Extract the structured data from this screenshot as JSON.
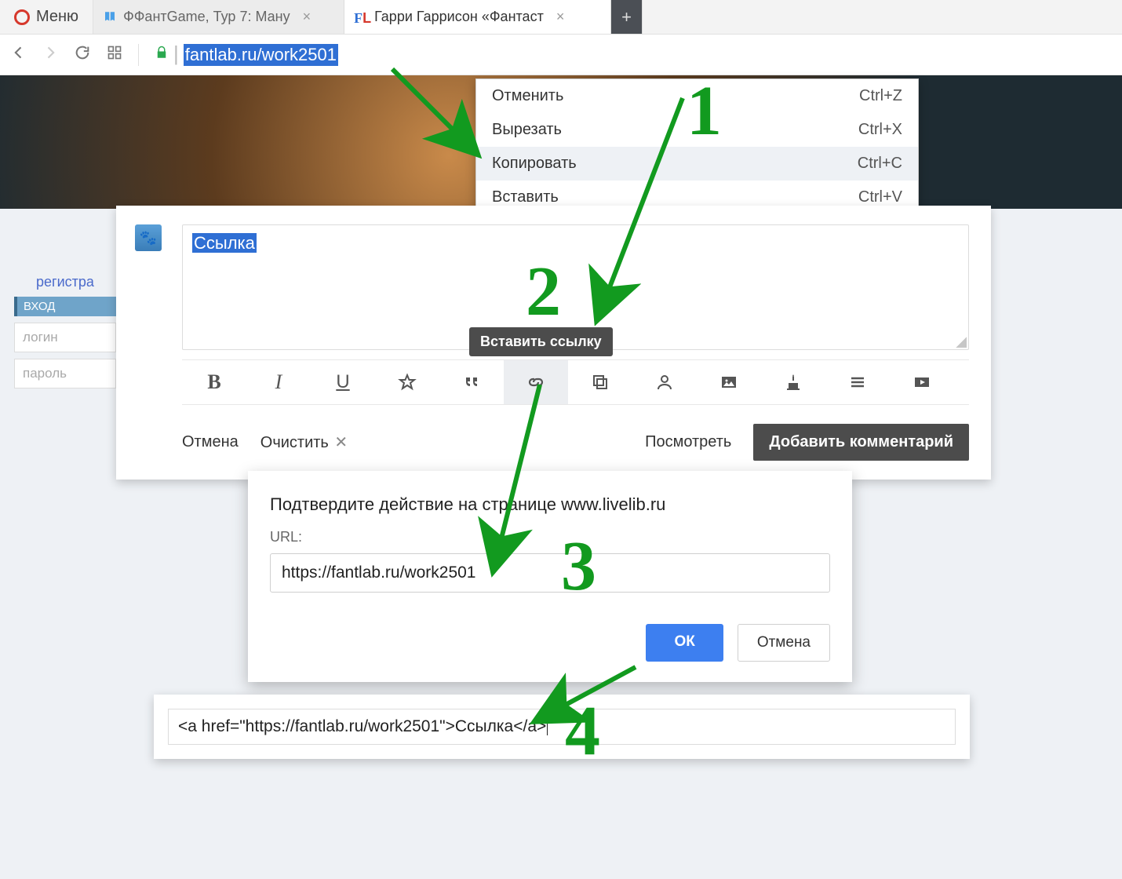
{
  "browser": {
    "menu_label": "Меню",
    "tabs": [
      {
        "title": "ФФантGame, Тур 7: Ману"
      },
      {
        "title": "Гарри Гаррисон «Фантаст"
      }
    ],
    "url_text": "fantlab.ru/work2501"
  },
  "context_menu": {
    "items": [
      {
        "label": "Отменить",
        "shortcut": "Ctrl+Z"
      },
      {
        "label": "Вырезать",
        "shortcut": "Ctrl+X"
      },
      {
        "label": "Копировать",
        "shortcut": "Ctrl+C"
      },
      {
        "label": "Вставить",
        "shortcut": "Ctrl+V"
      }
    ]
  },
  "sidebar": {
    "register": "регистра",
    "header": "ВХОД",
    "login_placeholder": "логин",
    "password_placeholder": "пароль"
  },
  "editor": {
    "selected_text": "Ссылка",
    "tooltip": "Вставить ссылку",
    "buttons": {
      "cancel": "Отмена",
      "clear": "Очистить",
      "preview": "Посмотреть",
      "submit": "Добавить комментарий"
    },
    "toolbar_icons": [
      "bold",
      "italic",
      "underline",
      "star",
      "quote",
      "link",
      "copy",
      "user",
      "image",
      "cake",
      "list",
      "video"
    ]
  },
  "dialog": {
    "title": "Подтвердите действие на странице www.livelib.ru",
    "url_label": "URL:",
    "url_value": "https://fantlab.ru/work2501",
    "ok": "ОК",
    "cancel": "Отмена"
  },
  "result": {
    "html": "<a href=\"https://fantlab.ru/work2501\">Ссылка</a>"
  },
  "steps": [
    "1",
    "2",
    "3",
    "4"
  ]
}
